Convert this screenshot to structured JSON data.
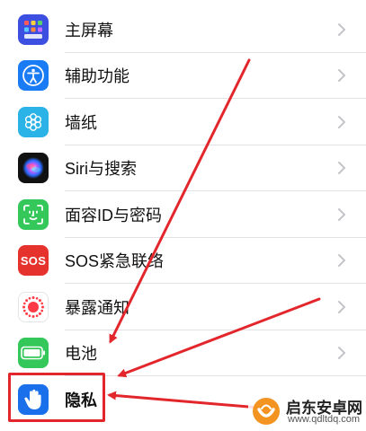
{
  "settings": {
    "items": [
      {
        "label": "主屏幕",
        "icon": "home-screen-grid-icon",
        "color": "#3d4fe0"
      },
      {
        "label": "辅助功能",
        "icon": "accessibility-icon",
        "color": "#1a7cf5"
      },
      {
        "label": "墙纸",
        "icon": "wallpaper-flower-icon",
        "color": "#2bb3e8"
      },
      {
        "label": "Siri与搜索",
        "icon": "siri-icon",
        "color": "#111111"
      },
      {
        "label": "面容ID与密码",
        "icon": "face-id-icon",
        "color": "#34c759"
      },
      {
        "label": "SOS紧急联络",
        "icon": "sos-icon",
        "color": "#e5322d",
        "icon_text": "SOS"
      },
      {
        "label": "暴露通知",
        "icon": "exposure-notification-icon",
        "color": "#ffffff"
      },
      {
        "label": "电池",
        "icon": "battery-icon",
        "color": "#34c759"
      },
      {
        "label": "隐私",
        "icon": "privacy-hand-icon",
        "color": "#1a6fea"
      }
    ]
  },
  "annotation": {
    "arrow_color": "#e2262b"
  },
  "watermark": {
    "title": "启东安卓网",
    "url": "www.qdltdq.com"
  }
}
